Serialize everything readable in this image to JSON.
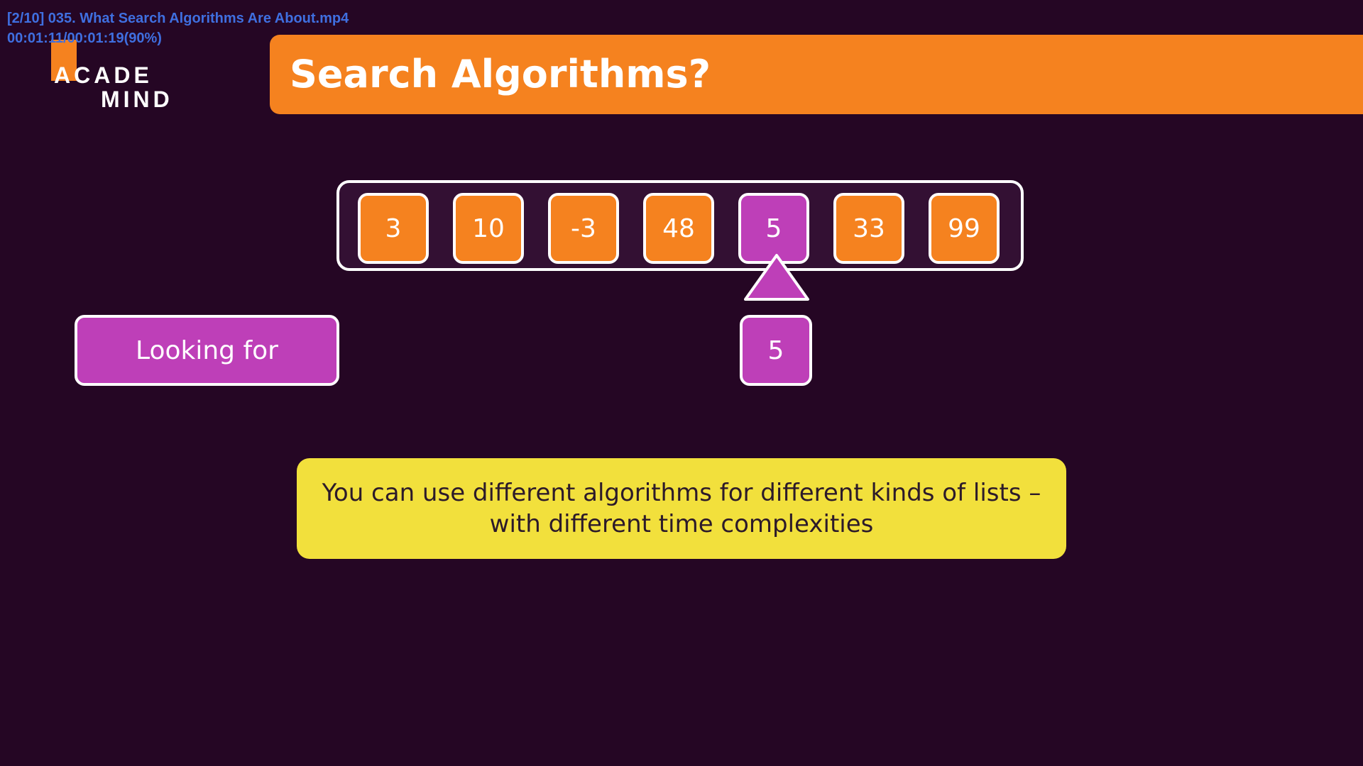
{
  "osd": {
    "file_line": "[2/10] 035. What Search Algorithms Are About.mp4",
    "time_line": "00:01:11/00:01:19(90%)"
  },
  "logo": {
    "line1": "ACADE",
    "line2": "MIND"
  },
  "slide": {
    "title": "Search Algorithms?",
    "array": [
      "3",
      "10",
      "-3",
      "48",
      "5",
      "33",
      "99"
    ],
    "highlighted_index": 4,
    "looking_for_label": "Looking for",
    "target_value": "5",
    "note_line1": "You can use different algorithms for different kinds of lists –",
    "note_line2": "with different time complexities"
  },
  "colors": {
    "background": "#250624",
    "orange": "#f5821f",
    "magenta": "#be3fb8",
    "yellow": "#f2e03c",
    "osd_text": "#3f6fe0"
  }
}
